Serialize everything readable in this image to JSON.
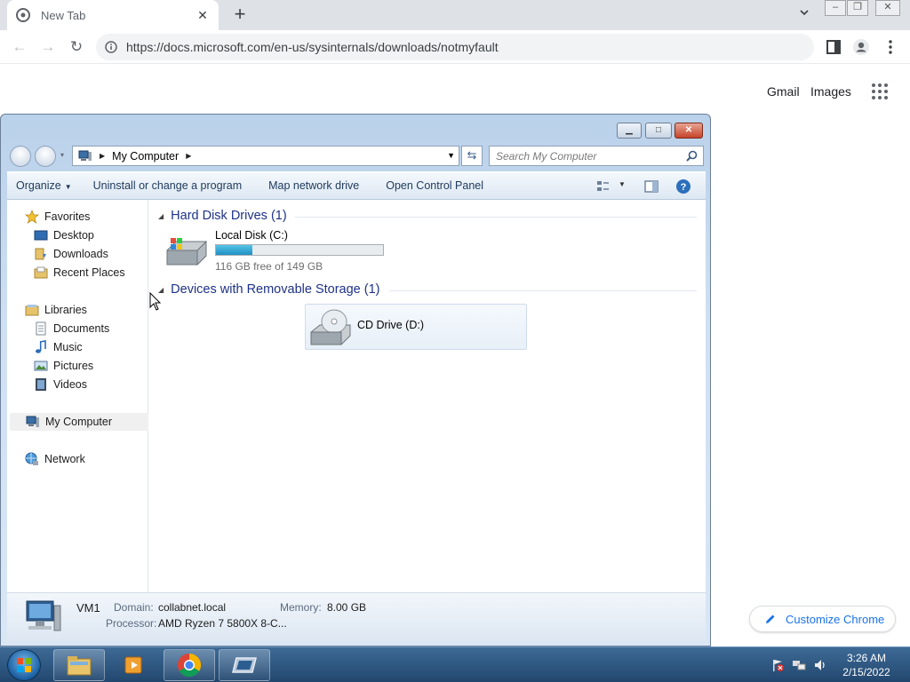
{
  "browser": {
    "tab_title": "New Tab",
    "url": "https://docs.microsoft.com/en-us/sysinternals/downloads/notmyfault",
    "links": {
      "gmail": "Gmail",
      "images": "Images"
    },
    "customize_label": "Customize Chrome"
  },
  "explorer": {
    "breadcrumb": "My Computer",
    "search_placeholder": "Search My Computer",
    "commands": [
      "Organize",
      "Uninstall or change a program",
      "Map network drive",
      "Open Control Panel"
    ],
    "nav": {
      "favorites": "Favorites",
      "desktop": "Desktop",
      "downloads": "Downloads",
      "recent": "Recent Places",
      "libraries": "Libraries",
      "documents": "Documents",
      "music": "Music",
      "pictures": "Pictures",
      "videos": "Videos",
      "computer": "My Computer",
      "network": "Network"
    },
    "groups": {
      "hdd": "Hard Disk Drives (1)",
      "removable": "Devices with Removable Storage (1)"
    },
    "drives": {
      "c_name": "Local Disk (C:)",
      "c_space": "116 GB free of 149 GB",
      "c_used_fraction": 0.22,
      "d_name": "CD Drive (D:)"
    },
    "details": {
      "name": "VM1",
      "domain_label": "Domain:",
      "domain": "collabnet.local",
      "memory_label": "Memory:",
      "memory": "8.00 GB",
      "processor_label": "Processor:",
      "processor": "AMD Ryzen 7 5800X 8-C..."
    }
  },
  "taskbar": {
    "time": "3:26 AM",
    "date": "2/15/2022"
  }
}
